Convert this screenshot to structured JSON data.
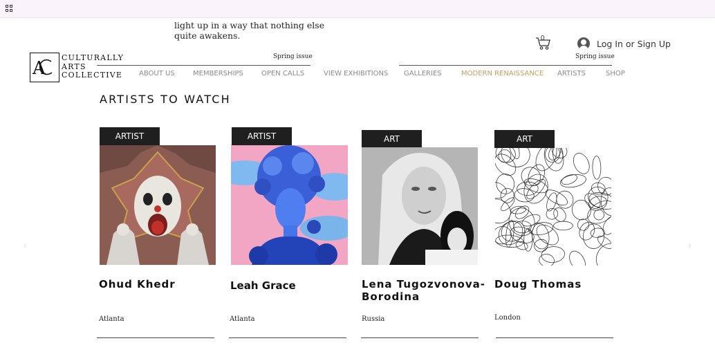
{
  "teaser": {
    "line1": "light up in a way that nothing else",
    "line2": "quite awakens."
  },
  "cart": {
    "count": "0"
  },
  "login": {
    "label": "Log In or Sign Up"
  },
  "logo": {
    "line1": "CULTURALLY",
    "line2": "ARTS",
    "line3": "COLLECTIVE"
  },
  "issues": {
    "left": "Spring issue",
    "right": "Spring issue"
  },
  "nav": {
    "items": [
      "ABOUT US",
      "MEMBERSHIPS",
      "OPEN CALLS",
      "VIEW EXHIBITIONS",
      "GALLERIES",
      "MODERN RENAISSANCE",
      "ARTISTS",
      "SHOP"
    ],
    "active_color": "#c1a164"
  },
  "section": {
    "title": "ARTISTS TO WATCH"
  },
  "cards": [
    {
      "tag": "ARTIST",
      "name": "Ohud Khedr",
      "location": "Atlanta"
    },
    {
      "tag": "ARTIST",
      "name": "Leah Grace",
      "location": "Atlanta"
    },
    {
      "tag": "ART",
      "name": "Lena Tugozvonova-Borodina",
      "location": "Russia"
    },
    {
      "tag": "ART",
      "name": "Doug Thomas",
      "location": "London"
    }
  ],
  "carousel": {
    "prev_icon": "chevron-left-icon",
    "next_icon": "chevron-right-icon",
    "prev": "‹",
    "next": "›"
  }
}
